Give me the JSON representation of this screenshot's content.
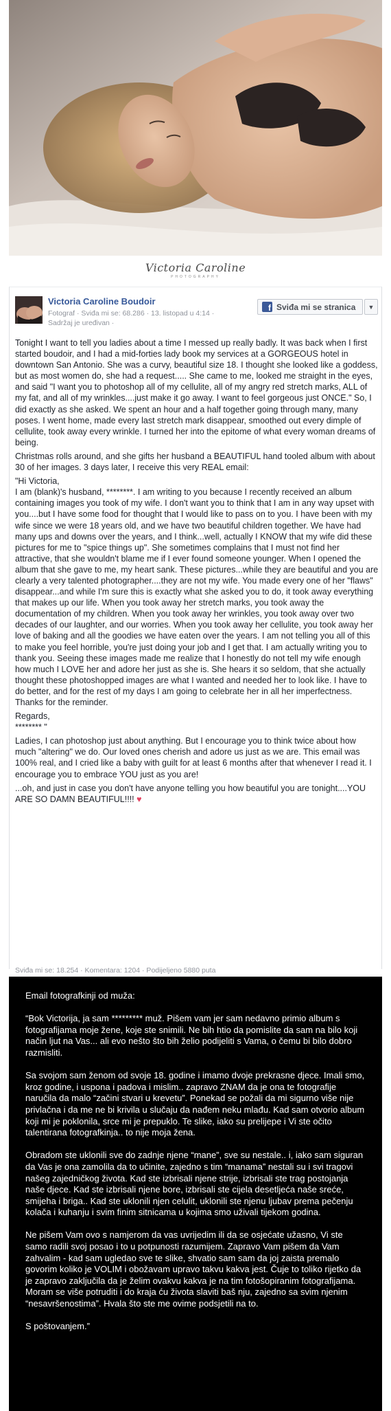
{
  "hero": {
    "image": "boudoir-photo",
    "alt_icon": "photo-icon"
  },
  "signature": {
    "name": "Victoria Caroline",
    "sub": "PHOTOGRAPHY"
  },
  "post": {
    "page_name": "Victoria Caroline Boudoir",
    "meta_line1": "Fotograf · Sviđa mi se: 68.286 · 13. listopad u 4:14 ·",
    "meta_line2": "Sadržaj je uređivan ·",
    "like_button": "Sviđa mi se stranica",
    "paragraphs": [
      "Tonight I want to tell you ladies about a time I messed up really badly. It was back when I first started boudoir, and I had a mid-forties lady book my services at a GORGEOUS hotel in downtown San Antonio. She was a curvy, beautiful size 18. I thought she looked like a goddess, but as most women do, she had a request..... She came to me, looked me straight in the eyes, and said \"I want you to photoshop all of my cellulite, all of my angry red stretch marks, ALL of my fat, and all of my wrinkles....just make it go away. I want to feel gorgeous just ONCE.\" So, I did exactly as she asked. We spent an hour and a half together going through many, many poses. I went home, made every last stretch mark disappear, smoothed out every dimple of cellulite, took away every wrinkle. I turned her into the epitome of what every woman dreams of being.",
      "Christmas rolls around, and she gifts her husband a BEAUTIFUL hand tooled album with about 30 of her images. 3 days later, I receive this very REAL email:",
      "\"Hi Victoria,",
      "I am (blank)'s husband, ********. I am writing to you because I recently received an album containing images you took of my wife. I don't want you to think that I am in any way upset with you....but I have some food for thought that I would like to pass on to you. I have been with my wife since we were 18 years old, and we have two beautiful children together. We have had many ups and downs over the years, and I think...well, actually I KNOW that my wife did these pictures for me to \"spice things up\". She sometimes complains that I must not find her attractive, that she wouldn't blame me if I ever found someone younger. When I opened the album that she gave to me, my heart sank. These pictures...while they are beautiful and you are clearly a very talented photographer....they are not my wife. You made every one of her \"flaws\" disappear...and while I'm sure this is exactly what she asked you to do, it took away everything that makes up our life. When you took away her stretch marks, you took away the documentation of my children. When you took away her wrinkles, you took away over two decades of our laughter, and our worries. When you took away her cellulite, you took away her love of baking and all the goodies we have eaten over the years. I am not telling you all of this to make you feel horrible, you're just doing your job and I get that. I am actually writing you to thank you. Seeing these images made me realize that I honestly do not tell my wife enough how much I LOVE her and adore her just as she is. She hears it so seldom, that she actually thought these photoshopped images are what I wanted and needed her to look like. I have to do better, and for the rest of my days I am going to celebrate her in all her imperfectness. Thanks for the reminder.",
      "Regards,",
      "******** \"",
      "Ladies, I can photoshop just about anything. But I encourage you to think twice about how much \"altering\" we do. Our loved ones cherish and adore us just as we are. This email was 100% real, and I cried like a baby with guilt for at least 6 months after that whenever I read it. I encourage you to embrace YOU just as you are!",
      "...oh, and just in case you don't have anyone telling you how beautiful you are tonight....YOU ARE SO DAMN BEAUTIFUL!!!!"
    ],
    "heart": "♥",
    "stats": "Sviđa mi se: 18.254 · Komentara: 1204 · Podijeljeno 5880 puta"
  },
  "translation": {
    "title": "Email fotografkinji od muža:",
    "paragraphs": [
      "“Bok Victorija, ja sam ********* muž. Pišem vam jer sam nedavno primio album s fotografijama moje žene, koje ste snimili. Ne bih htio da pomislite da sam na bilo koji način ljut na Vas... ali evo nešto što bih želio podijeliti s Vama, o čemu bi bilo dobro razmisliti.",
      "Sa svojom sam ženom od svoje 18. godine i imamo dvoje prekrasne djece. Imali smo, kroz godine, i uspona i padova i mislim.. zapravo ZNAM da je ona te fotografije naručila da malo “začini stvari u krevetu”. Ponekad se požali da mi sigurno više nije privlačna i da me ne bi krivila u slučaju da nađem neku mlađu. Kad sam otvorio album koji mi je poklonila, srce mi je prepuklo. Te slike, iako su prelijepe i Vi ste očito talentirana fotografkinja.. to nije moja žena.",
      "Obradom ste uklonili sve do zadnje njene “mane”, sve su nestale.. i, iako sam siguran da Vas je ona zamolila da to učinite, zajedno s tim “manama” nestali su i svi tragovi našeg zajedničkog života. Kad ste izbrisali njene strije, izbrisali ste trag postojanja naše djece. Kad ste izbrisali njene bore, izbrisali ste cijela desetljeća naše sreće, smijeha i briga.. Kad ste uklonili njen celulit, uklonili ste njenu ljubav prema pečenju kolača i kuhanju i svim finim sitnicama u kojima smo uživali tijekom godina.",
      "Ne pišem Vam ovo s namjerom da vas uvrijedim ili da se osjećate užasno, Vi ste samo radili svoj posao i to u potpunosti razumijem. Zapravo Vam pišem da Vam zahvalim - kad sam ugledao sve te slike, shvatio sam sam da joj zaista premalo govorim koliko je VOLIM i obožavam upravo takvu kakva jest. Čuje to toliko rijetko da je zapravo zaključila da je želim ovakvu kakva je na tim fotošopiranim fotografijama. Moram se više potruditi i do kraja ću života slaviti baš nju, zajedno sa svim njenim “nesavršenostima”. Hvala što ste me ovime podsjetili na to.",
      "S poštovanjem.”"
    ]
  }
}
